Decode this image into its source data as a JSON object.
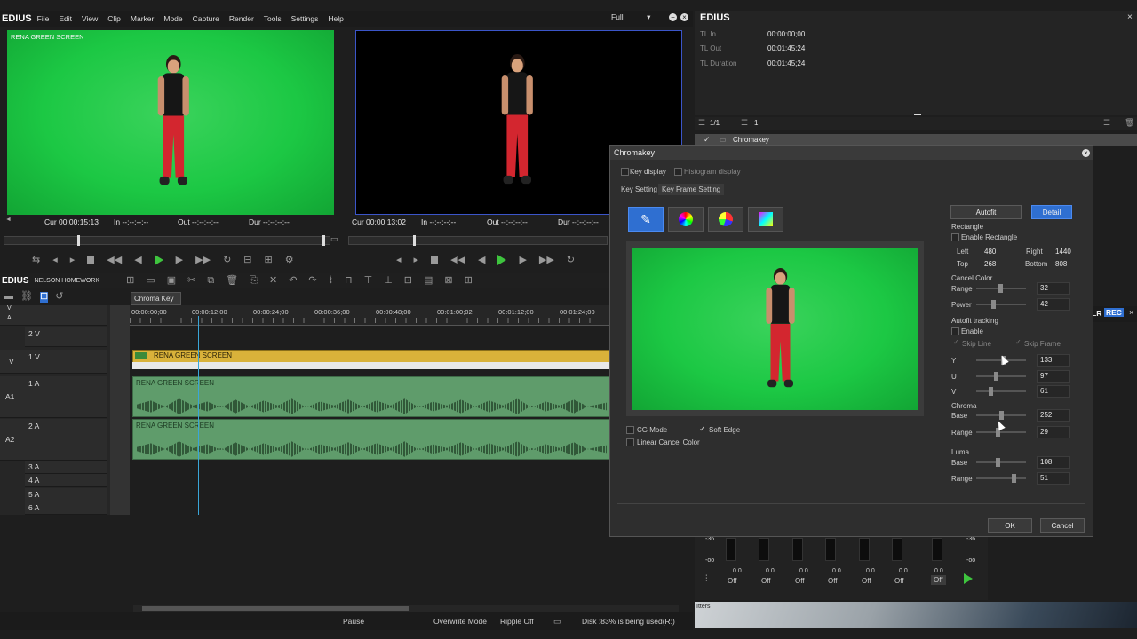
{
  "app": {
    "brand": "EDIUS"
  },
  "menu": [
    "File",
    "Edit",
    "View",
    "Clip",
    "Marker",
    "Mode",
    "Capture",
    "Render",
    "Tools",
    "Settings",
    "Help"
  ],
  "quality": {
    "value": "Full"
  },
  "player": {
    "clip_label": "RENA GREEN SCREEN",
    "cur": "Cur 00:00:15;13",
    "in": "In --:--:--;--",
    "out": "Out --:--:--;--",
    "dur": "Dur --:--:--;--"
  },
  "recorder": {
    "cur": "Cur 00:00:13;02",
    "in": "In --:--:--;--",
    "out": "Out --:--:--;--",
    "dur": "Dur --:--:--;--"
  },
  "info_panel": {
    "brand": "EDIUS",
    "rows": [
      {
        "label": "TL In",
        "value": "00:00:00;00"
      },
      {
        "label": "TL Out",
        "value": "00:01:45;24"
      },
      {
        "label": "TL Duration",
        "value": "00:01:45;24"
      }
    ],
    "page_a": "1/1",
    "page_b": "1",
    "effect_item": "Chromakey",
    "layer_rec": "LR REC",
    "thumb_text": "Itters"
  },
  "timeline": {
    "brand": "EDIUS",
    "project": "NELSON HOMEWORK",
    "tab": "Chroma Key",
    "ruler": [
      "00:00:00;00",
      "00:00:12;00",
      "00:00:24;00",
      "00:00:36;00",
      "00:00:48;00",
      "00:01:00;02",
      "00:01:12;00",
      "00:01:24;00"
    ],
    "tracks": [
      {
        "id": "2 V"
      },
      {
        "id": "1 V",
        "side": "V"
      },
      {
        "id": "1 A",
        "side": "A1"
      },
      {
        "id": "2 A",
        "side": "A2"
      },
      {
        "id": "3 A"
      },
      {
        "id": "4 A"
      },
      {
        "id": "5 A"
      },
      {
        "id": "6 A"
      }
    ],
    "top_labels": {
      "v": "V",
      "a": "A"
    },
    "clip_video": "RENA GREEN SCREEN",
    "clip_audio1": "RENA GREEN SCREEN",
    "clip_audio2": "RENA GREEN SCREEN"
  },
  "dialog": {
    "title": "Chromakey",
    "key_display": "Key display",
    "histogram_display": "Histogram display",
    "tab_key": "Key Setting",
    "tab_frame": "Key Frame Setting",
    "autofit": "Autofit",
    "detail": "Detail",
    "rectangle": "Rectangle",
    "enable_rectangle": "Enable Rectangle",
    "left_label": "Left",
    "left_val": "480",
    "right_label": "Right",
    "right_val": "1440",
    "top_label": "Top",
    "top_val": "268",
    "bottom_label": "Bottom",
    "bottom_val": "808",
    "cancel_color": "Cancel Color",
    "range_label": "Range",
    "range_val": "32",
    "power_label": "Power",
    "power_val": "42",
    "autofit_tracking": "Autofit tracking",
    "enable": "Enable",
    "skip_line": "Skip Line",
    "skip_frame": "Skip Frame",
    "y_label": "Y",
    "y_val": "133",
    "u_label": "U",
    "u_val": "97",
    "v_label": "V",
    "v_val": "61",
    "chroma": "Chroma",
    "chroma_base_label": "Base",
    "chroma_base_val": "252",
    "chroma_range_label": "Range",
    "chroma_range_val": "29",
    "luma": "Luma",
    "luma_base_label": "Base",
    "luma_base_val": "108",
    "luma_range_label": "Range",
    "luma_range_val": "51",
    "cg_mode": "CG Mode",
    "soft_edge": "Soft Edge",
    "linear_cancel": "Linear Cancel Color",
    "ok": "OK",
    "cancel": "Cancel"
  },
  "mixer": {
    "scale_top": "-36",
    "scale_bottom": "-oo",
    "levels": [
      "0.0",
      "0.0",
      "0.0",
      "0.0",
      "0.0",
      "0.0",
      "0.0"
    ],
    "states": [
      "Off",
      "Off",
      "Off",
      "Off",
      "Off",
      "Off",
      "Off"
    ]
  },
  "status": {
    "pause": "Pause",
    "mode": "Overwrite Mode",
    "ripple": "Ripple Off",
    "disk": "Disk :83% is being used(R:)"
  },
  "colors": {
    "accent": "#2f6fd1",
    "green": "#3ec43e",
    "clip_video": "#d9b23a",
    "clip_audio": "#5f9c6b"
  }
}
